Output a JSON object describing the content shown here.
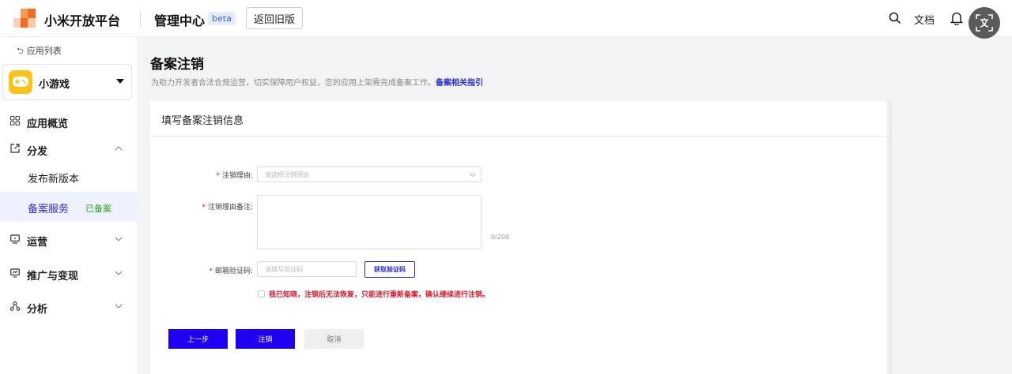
{
  "header": {
    "brand": "小米开放平台",
    "section": "管理中心",
    "badge": "beta",
    "old_version_label": "返回旧版",
    "docs_label": "文档",
    "icons": [
      "search-icon",
      "bell-icon",
      "translate-icon"
    ]
  },
  "sidebar": {
    "back_label": "应用列表",
    "app_name": "小游戏",
    "items": [
      {
        "label": "应用概览",
        "icon": "grid-icon"
      },
      {
        "label": "分发",
        "icon": "share-icon",
        "expanded": true
      },
      {
        "label": "发布新版本"
      },
      {
        "label": "备案服务",
        "tag": "已备案",
        "active": true
      },
      {
        "label": "运营",
        "icon": "monitor-icon"
      },
      {
        "label": "推广与变现",
        "icon": "promote-icon"
      },
      {
        "label": "分析",
        "icon": "analysis-icon"
      }
    ]
  },
  "main": {
    "title": "备案注销",
    "description": "为助力开发者合法合规运营，切实保障用户权益，您的应用上架需完成备案工作。",
    "guide_link": "备案相关指引",
    "card_title": "填写备案注销信息",
    "form": {
      "reason_label": "注销理由:",
      "reason_placeholder": "请选择注销理由",
      "remark_label": "注销理由备注:",
      "remark_counter": "0/200",
      "code_label": "邮箱验证码:",
      "code_placeholder": "请填写验证码",
      "get_code_label": "获取验证码",
      "agreement_text": "我已知晓，注销后无法恢复，只能进行重新备案，确认继续进行注销。"
    },
    "buttons": {
      "prev": "上一步",
      "submit": "注销",
      "cancel": "取消"
    }
  },
  "colors": {
    "primary": "#1f00f0",
    "link": "#2b2bdd",
    "danger": "#e0182d",
    "success": "#31a01f"
  }
}
